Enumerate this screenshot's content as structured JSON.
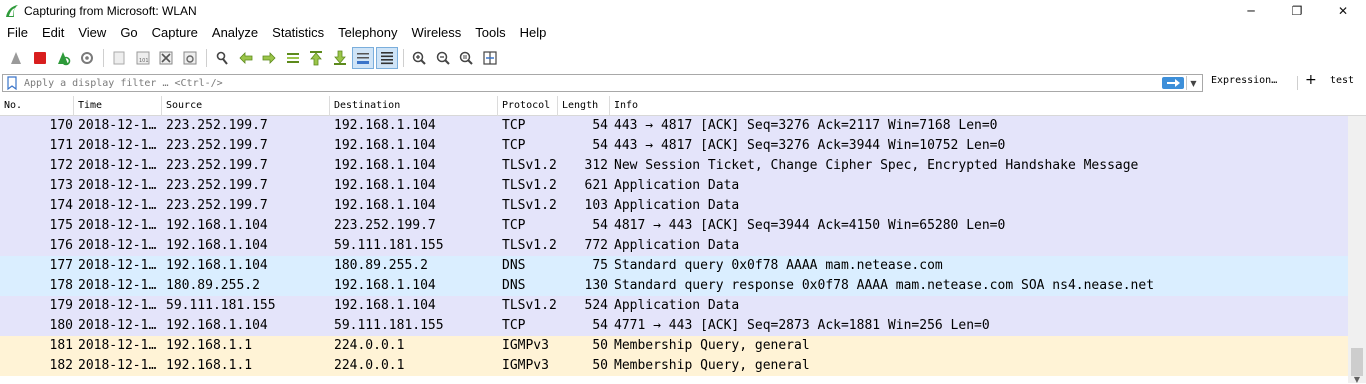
{
  "window": {
    "title": "Capturing from Microsoft: WLAN",
    "minimize": "─",
    "maximize": "❐",
    "close": "✕"
  },
  "menu": [
    "File",
    "Edit",
    "View",
    "Go",
    "Capture",
    "Analyze",
    "Statistics",
    "Telephony",
    "Wireless",
    "Tools",
    "Help"
  ],
  "toolbar": {
    "icons": [
      "shark-fin-start-icon",
      "stop-capture-icon",
      "restart-capture-icon",
      "capture-options-icon",
      "open-file-icon",
      "save-file-icon",
      "close-file-icon",
      "reload-file-icon",
      "find-packet-icon",
      "go-back-icon",
      "go-forward-icon",
      "go-to-packet-icon",
      "go-first-icon",
      "go-last-icon",
      "autoscroll-icon",
      "colorize-icon",
      "zoom-in-icon",
      "zoom-out-icon",
      "normal-size-icon",
      "resize-columns-icon"
    ]
  },
  "filter": {
    "placeholder": "Apply a display filter … <Ctrl-/>",
    "expression_label": "Expression…",
    "plus_label": "+",
    "test_label": "test"
  },
  "columns": {
    "no": "No.",
    "time": "Time",
    "source": "Source",
    "destination": "Destination",
    "protocol": "Protocol",
    "length": "Length",
    "info": "Info"
  },
  "colors": {
    "tcp_row": "#e4e4fa",
    "dns_row": "#daeeff",
    "igmp_row": "#fff3d6"
  },
  "packets": [
    {
      "no": "170",
      "time": "2018-12-1…",
      "source": "223.252.199.7",
      "destination": "192.168.1.104",
      "protocol": "TCP",
      "length": "54",
      "info": "443 → 4817 [ACK] Seq=3276 Ack=2117 Win=7168 Len=0",
      "kind": "tcp"
    },
    {
      "no": "171",
      "time": "2018-12-1…",
      "source": "223.252.199.7",
      "destination": "192.168.1.104",
      "protocol": "TCP",
      "length": "54",
      "info": "443 → 4817 [ACK] Seq=3276 Ack=3944 Win=10752 Len=0",
      "kind": "tcp"
    },
    {
      "no": "172",
      "time": "2018-12-1…",
      "source": "223.252.199.7",
      "destination": "192.168.1.104",
      "protocol": "TLSv1.2",
      "length": "312",
      "info": "New Session Ticket, Change Cipher Spec, Encrypted Handshake Message",
      "kind": "tcp"
    },
    {
      "no": "173",
      "time": "2018-12-1…",
      "source": "223.252.199.7",
      "destination": "192.168.1.104",
      "protocol": "TLSv1.2",
      "length": "621",
      "info": "Application Data",
      "kind": "tcp"
    },
    {
      "no": "174",
      "time": "2018-12-1…",
      "source": "223.252.199.7",
      "destination": "192.168.1.104",
      "protocol": "TLSv1.2",
      "length": "103",
      "info": "Application Data",
      "kind": "tcp"
    },
    {
      "no": "175",
      "time": "2018-12-1…",
      "source": "192.168.1.104",
      "destination": "223.252.199.7",
      "protocol": "TCP",
      "length": "54",
      "info": "4817 → 443 [ACK] Seq=3944 Ack=4150 Win=65280 Len=0",
      "kind": "tcp"
    },
    {
      "no": "176",
      "time": "2018-12-1…",
      "source": "192.168.1.104",
      "destination": "59.111.181.155",
      "protocol": "TLSv1.2",
      "length": "772",
      "info": "Application Data",
      "kind": "tcp"
    },
    {
      "no": "177",
      "time": "2018-12-1…",
      "source": "192.168.1.104",
      "destination": "180.89.255.2",
      "protocol": "DNS",
      "length": "75",
      "info": "Standard query 0x0f78 AAAA mam.netease.com",
      "kind": "dns"
    },
    {
      "no": "178",
      "time": "2018-12-1…",
      "source": "180.89.255.2",
      "destination": "192.168.1.104",
      "protocol": "DNS",
      "length": "130",
      "info": "Standard query response 0x0f78 AAAA mam.netease.com SOA ns4.nease.net",
      "kind": "dns"
    },
    {
      "no": "179",
      "time": "2018-12-1…",
      "source": "59.111.181.155",
      "destination": "192.168.1.104",
      "protocol": "TLSv1.2",
      "length": "524",
      "info": "Application Data",
      "kind": "tcp"
    },
    {
      "no": "180",
      "time": "2018-12-1…",
      "source": "192.168.1.104",
      "destination": "59.111.181.155",
      "protocol": "TCP",
      "length": "54",
      "info": "4771 → 443 [ACK] Seq=2873 Ack=1881 Win=256 Len=0",
      "kind": "tcp"
    },
    {
      "no": "181",
      "time": "2018-12-1…",
      "source": "192.168.1.1",
      "destination": "224.0.0.1",
      "protocol": "IGMPv3",
      "length": "50",
      "info": "Membership Query, general",
      "kind": "igmp"
    },
    {
      "no": "182",
      "time": "2018-12-1…",
      "source": "192.168.1.1",
      "destination": "224.0.0.1",
      "protocol": "IGMPv3",
      "length": "50",
      "info": "Membership Query, general",
      "kind": "igmp"
    }
  ]
}
